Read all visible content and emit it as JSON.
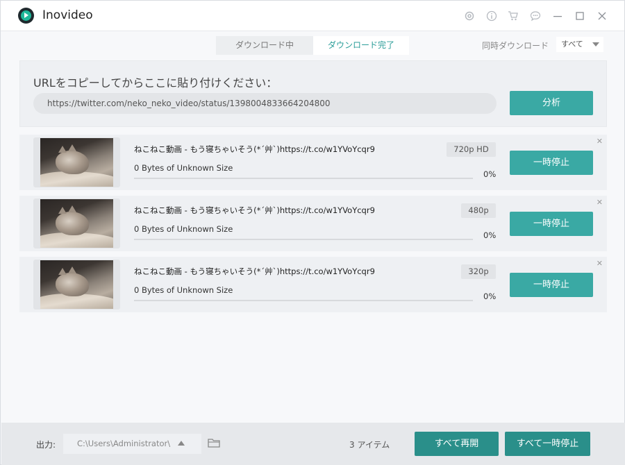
{
  "app": {
    "title": "Inovideo"
  },
  "tabs": [
    {
      "label": "ダウンロード中",
      "active": false
    },
    {
      "label": "ダウンロード完了",
      "active": true
    }
  ],
  "concurrent": {
    "label": "同時ダウンロード",
    "value": "すべて"
  },
  "url_panel": {
    "heading": "URLをコピーしてからここに貼り付けください：",
    "url_value": "https://twitter.com/neko_neko_video/status/1398004833664204800",
    "analyze_label": "分析"
  },
  "items": [
    {
      "title": "ねこねこ動画 - もう寝ちゃいそう(*´艸`)https://t.co/w1YVoYcqr9",
      "size": "0 Bytes of Unknown Size",
      "quality": "720p HD",
      "progress_percent": 0,
      "progress_text": "0%",
      "pause_label": "一時停止"
    },
    {
      "title": "ねこねこ動画 - もう寝ちゃいそう(*´艸`)https://t.co/w1YVoYcqr9",
      "size": "0 Bytes of Unknown Size",
      "quality": "480p",
      "progress_percent": 0,
      "progress_text": "0%",
      "pause_label": "一時停止"
    },
    {
      "title": "ねこねこ動画 - もう寝ちゃいそう(*´艸`)https://t.co/w1YVoYcqr9",
      "size": "0 Bytes of Unknown Size",
      "quality": "320p",
      "progress_percent": 0,
      "progress_text": "0%",
      "pause_label": "一時停止"
    }
  ],
  "footer": {
    "output_label": "出力:",
    "output_path": "C:\\Users\\Administrator\\",
    "item_count": "3 アイテム",
    "resume_all_label": "すべて再開",
    "pause_all_label": "すべて一時停止"
  },
  "colors": {
    "accent": "#3aa9a4",
    "accent_dark": "#2a8f8a",
    "brand": "#1fb89a"
  },
  "icons": [
    "settings-icon",
    "info-icon",
    "cart-icon",
    "feedback-icon",
    "minimize-icon",
    "maximize-icon",
    "close-icon",
    "folder-icon"
  ]
}
